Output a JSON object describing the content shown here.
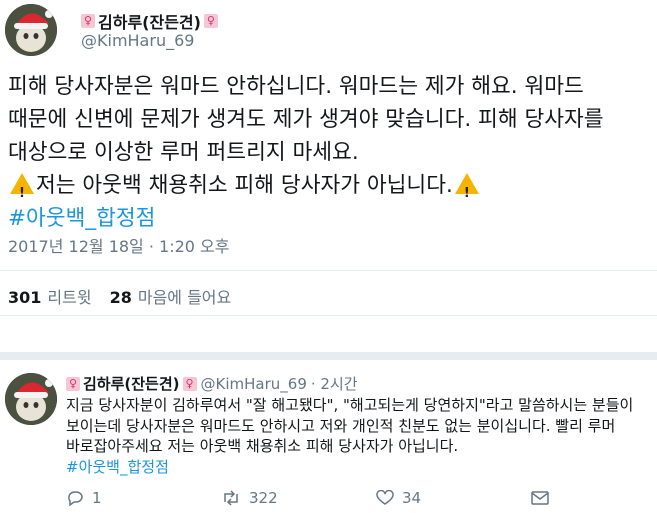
{
  "main_tweet": {
    "display_name": "김하루(잔든견)",
    "handle": "@KimHaru_69",
    "text_lines": [
      "피해 당사자분은 워마드 안하십니다. 워마드는 제가 해요. 워마드",
      "때문에 신변에 문제가 생겨도 제가 생겨야 맞습니다. 피해 당사자를",
      "대상으로 이상한 루머 퍼트리지 마세요."
    ],
    "warning_line": "저는 아웃백 채용취소 피해 당사자가 아닙니다.",
    "hashtag": "#아웃백_합정점",
    "timestamp": "2017년 12월 18일 · 1:20 오후",
    "retweet_count": "301",
    "retweet_label": "리트윗",
    "like_count": "28",
    "like_label": "마음에 들어요"
  },
  "reply_tweet": {
    "display_name": "김하루(잔든견)",
    "handle": "@KimHaru_69",
    "time": "· 2시간",
    "text_lines": [
      "지금 당사자분이 김하루여서 \"잘 해고됐다\", \"해고되는게 당연하지\"라고 말씀하시는 분들이",
      "보이는데 당사자분은 워마드도 안하시고 저와 개인적 친분도 없는 분이십니다. 빨리 루머",
      "바로잡아주세요 저는 아웃백 채용취소 피해 당사자가 아닙니다."
    ],
    "hashtag": "#아웃백_합정점",
    "reply_count": "1",
    "retweet_count": "322",
    "like_count": "34"
  },
  "icons": {
    "emoji": "female-sign-emoji",
    "warning": "warning-icon",
    "reply": "reply-icon",
    "retweet": "retweet-icon",
    "like": "heart-icon"
  },
  "colors": {
    "link": "#1b95e0",
    "secondary": "#657786",
    "warning": "#f5b400"
  }
}
